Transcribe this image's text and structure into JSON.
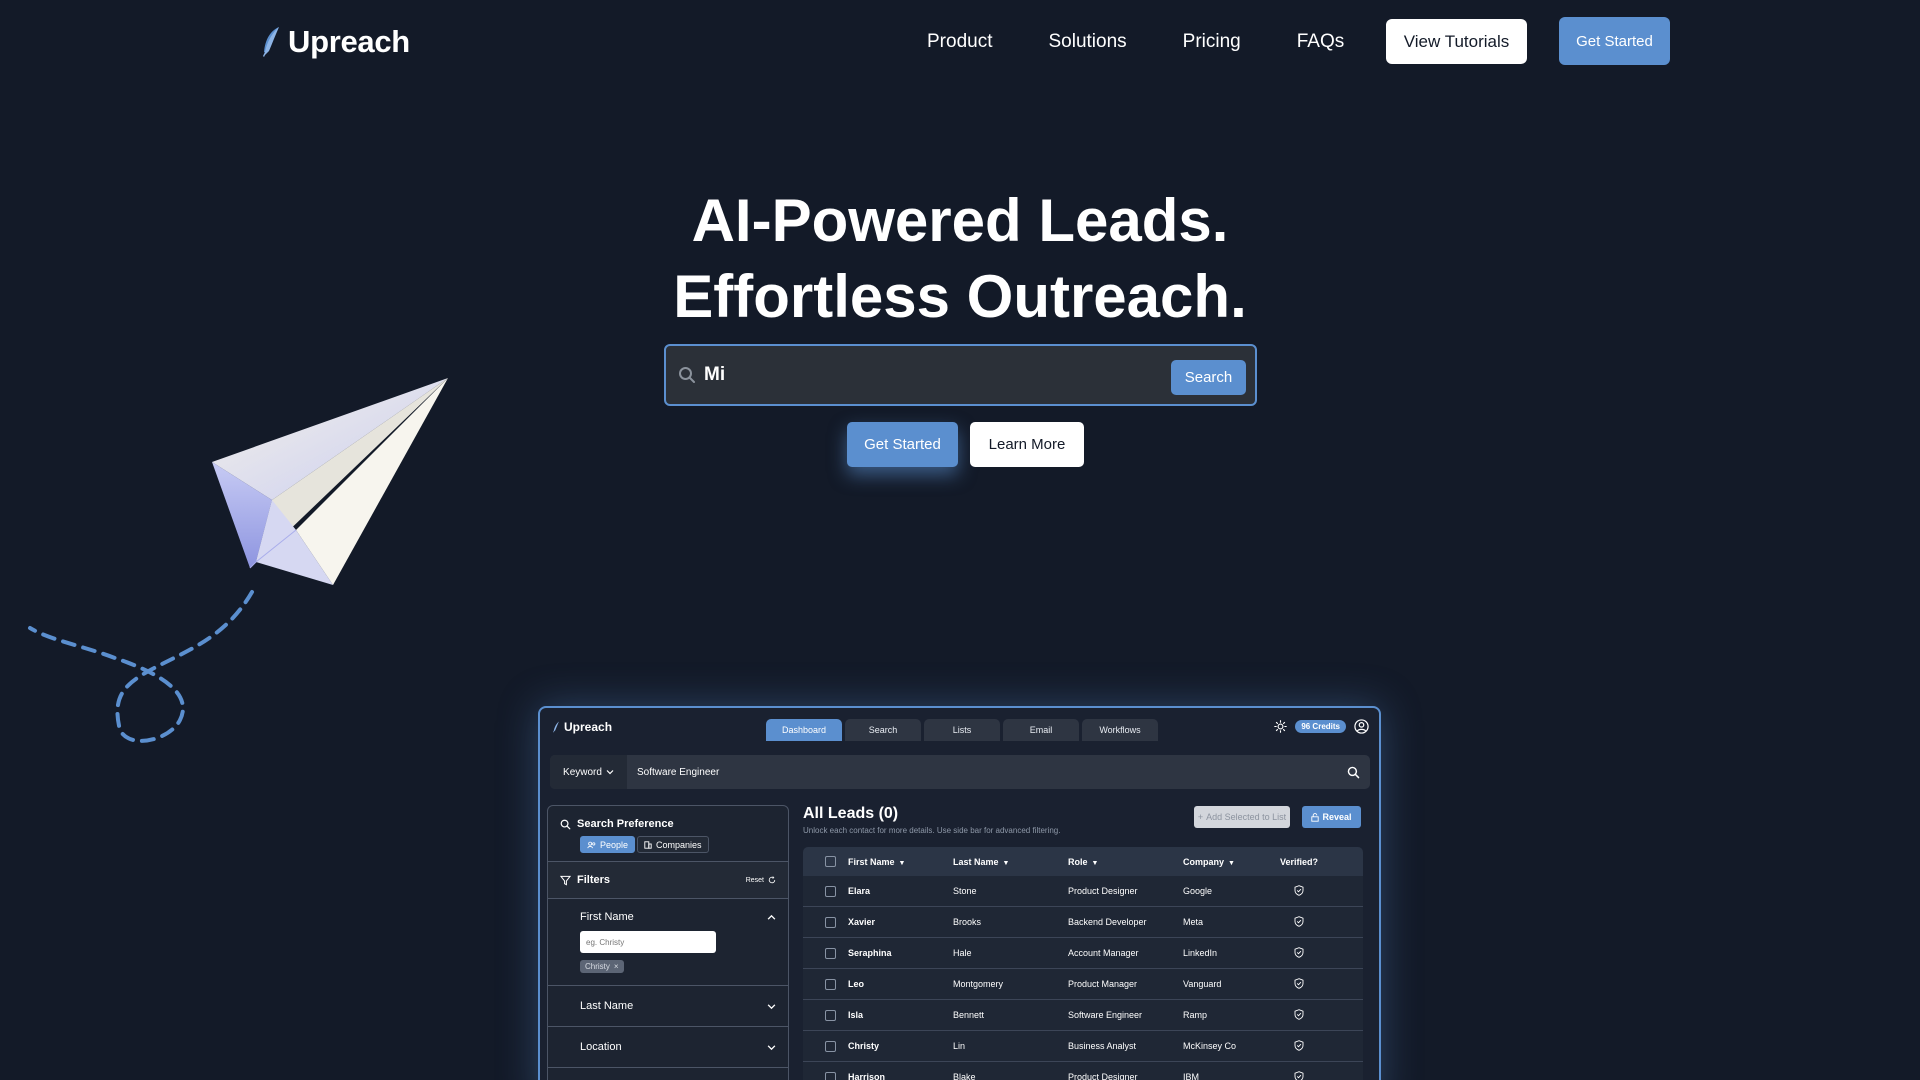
{
  "nav": {
    "brand": "Upreach",
    "links": [
      "Product",
      "Solutions",
      "Pricing",
      "FAQs"
    ],
    "tutorials_label": "View Tutorials",
    "get_started_label": "Get Started"
  },
  "hero": {
    "line1": "AI-Powered Leads.",
    "line2": "Effortless Outreach.",
    "search_value": "Mi",
    "search_button": "Search",
    "get_started": "Get Started",
    "learn_more": "Learn More"
  },
  "colors": {
    "accent": "#5b8fcf",
    "background": "#131a28"
  },
  "preview": {
    "brand": "Upreach",
    "tabs": [
      "Dashboard",
      "Search",
      "Lists",
      "Email",
      "Workflows"
    ],
    "active_tab": "Dashboard",
    "credits": "96 Credits",
    "keyword_label": "Keyword",
    "query": "Software Engineer",
    "search_pref_title": "Search Preference",
    "toggle_people": "People",
    "toggle_companies": "Companies",
    "filters_title": "Filters",
    "reset_label": "Reset",
    "first_name_label": "First Name",
    "first_name_placeholder": "eg. Christy",
    "chip": "Christy",
    "last_name_label": "Last Name",
    "location_label": "Location",
    "leads_title": "All Leads (0)",
    "leads_sub": "Unlock each contact for more details. Use side bar for advanced filtering.",
    "add_to_list": "Add Selected to List",
    "reveal": "Reveal",
    "columns": [
      "First Name",
      "Last Name",
      "Role",
      "Company",
      "Verified?"
    ],
    "rows": [
      [
        "Elara",
        "Stone",
        "Product Designer",
        "Google"
      ],
      [
        "Xavier",
        "Brooks",
        "Backend Developer",
        "Meta"
      ],
      [
        "Seraphina",
        "Hale",
        "Account Manager",
        "LinkedIn"
      ],
      [
        "Leo",
        "Montgomery",
        "Product Manager",
        "Vanguard"
      ],
      [
        "Isla",
        "Bennett",
        "Software Engineer",
        "Ramp"
      ],
      [
        "Christy",
        "Lin",
        "Business Analyst",
        "McKinsey Co"
      ],
      [
        "Harrison",
        "Blake",
        "Product Designer",
        "IBM"
      ]
    ]
  }
}
